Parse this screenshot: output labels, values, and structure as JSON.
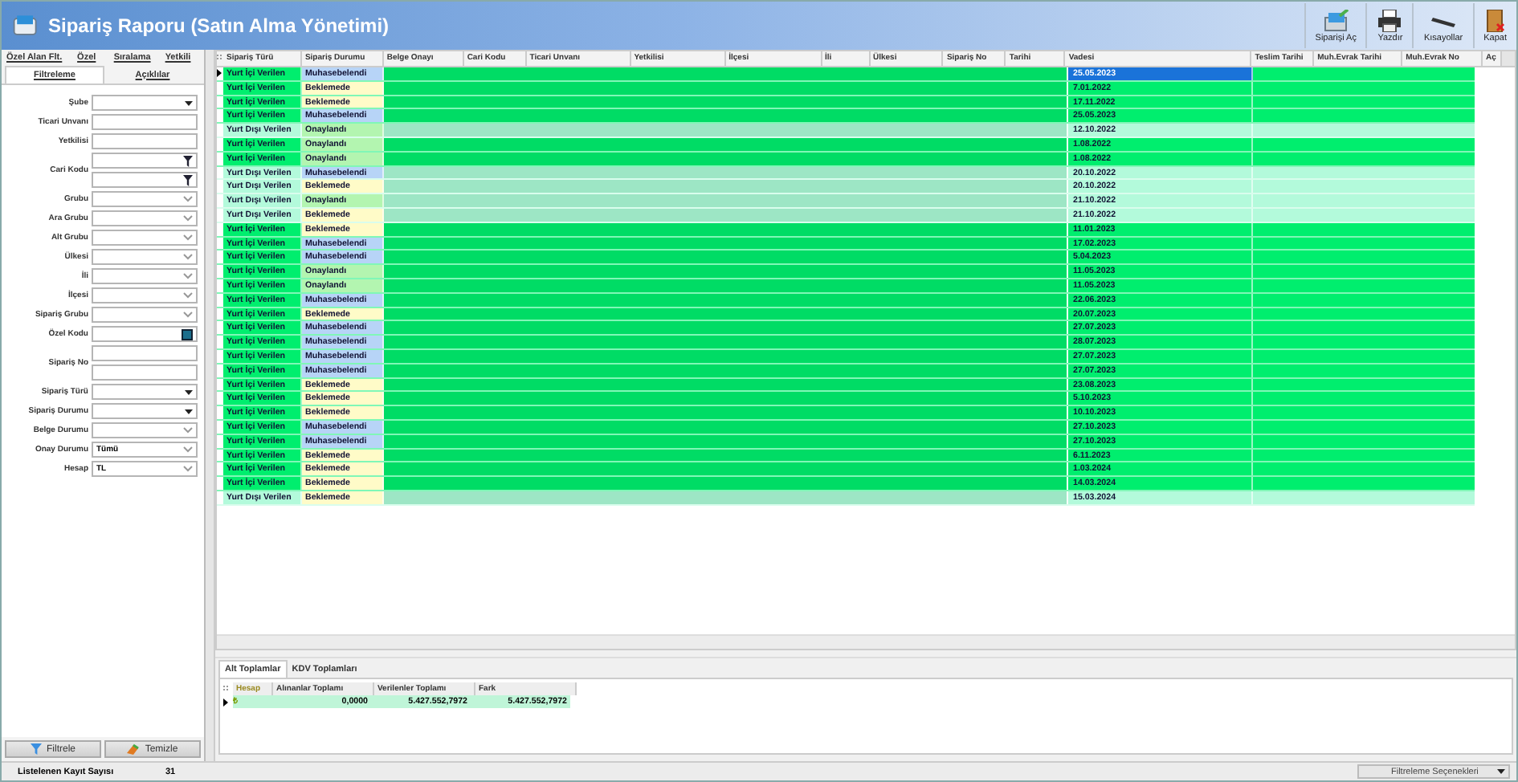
{
  "window": {
    "title": "Sipariş Raporu (Satın Alma Yönetimi)"
  },
  "toolbar": [
    {
      "label": "Siparişi Aç",
      "kind": "open"
    },
    {
      "label": "Yazdır",
      "kind": "print"
    },
    {
      "label": "Kısayollar",
      "kind": "shortcuts"
    },
    {
      "label": "Kapat",
      "kind": "close"
    }
  ],
  "filter_tabs": [
    [
      {
        "label": "Özel Alan Flt.",
        "selected": false
      },
      {
        "label": "Özel",
        "selected": false
      },
      {
        "label": "Sıralama",
        "selected": false
      },
      {
        "label": "Yetkili",
        "selected": false
      }
    ],
    [
      {
        "label": "Filtreleme",
        "selected": true
      },
      {
        "label": "Açıklılar",
        "selected": false
      }
    ]
  ],
  "filters": [
    {
      "label": "Şube",
      "kind": "dropdown"
    },
    {
      "label": "Ticari Unvanı",
      "kind": "text"
    },
    {
      "label": "Yetkilisi",
      "kind": "text"
    },
    {
      "label": "Cari Kodu",
      "kind": "lookup-pair"
    },
    {
      "label": "Grubu",
      "kind": "combo"
    },
    {
      "label": "Ara Grubu",
      "kind": "combo"
    },
    {
      "label": "Alt Grubu",
      "kind": "combo"
    },
    {
      "label": "Ülkesi",
      "kind": "combo"
    },
    {
      "label": "İli",
      "kind": "combo"
    },
    {
      "label": "İlçesi",
      "kind": "combo"
    },
    {
      "label": "Sipariş Grubu",
      "kind": "combo"
    },
    {
      "label": "Özel Kodu",
      "kind": "lookup"
    },
    {
      "label": "Sipariş No",
      "kind": "text-pair"
    },
    {
      "label": "Sipariş Türü",
      "kind": "dropdown"
    },
    {
      "label": "Sipariş Durumu",
      "kind": "dropdown"
    },
    {
      "label": "Belge Durumu",
      "kind": "combo"
    },
    {
      "label": "Onay Durumu",
      "kind": "combo",
      "value": "Tümü"
    },
    {
      "label": "Hesap",
      "kind": "combo",
      "value": "TL"
    }
  ],
  "filter_buttons": [
    {
      "label": "Filtrele",
      "kind": "filter"
    },
    {
      "label": "Temizle",
      "kind": "clear"
    }
  ],
  "status_bar": {
    "label": "Listelenen Kayıt Sayısı",
    "count": "31",
    "options": "Filtreleme Seçenekleri"
  },
  "table": {
    "columns": [
      "Sipariş Türü",
      "Sipariş Durumu",
      "Belge Onayı",
      "Cari Kodu",
      "Ticari Unvanı",
      "Yetkilisi",
      "İlçesi",
      "İli",
      "Ülkesi",
      "Sipariş No",
      "Tarihi",
      "Vadesi",
      "Teslim Tarihi",
      "Muh.Evrak Tarihi",
      "Muh.Evrak No",
      "Aç"
    ],
    "rows": [
      {
        "type": "Yurt İçi Verilen",
        "status": {
          "label": "Muhasebelendi",
          "color": "#b7d4f7"
        },
        "due": "25.05.2023",
        "selected": true,
        "color": "#00ee6e"
      },
      {
        "type": "Yurt İçi Verilen",
        "status": {
          "label": "Beklemede",
          "color": "#fffbc8"
        },
        "due": "7.01.2022",
        "selected": false,
        "color": "#00ee6e"
      },
      {
        "type": "Yurt İçi Verilen",
        "status": {
          "label": "Beklemede",
          "color": "#fffbc8"
        },
        "due": "17.11.2022",
        "selected": false,
        "color": "#00ee6e"
      },
      {
        "type": "Yurt İçi Verilen",
        "status": {
          "label": "Muhasebelendi",
          "color": "#b7d4f7"
        },
        "due": "25.05.2023",
        "selected": false,
        "color": "#00ee6e"
      },
      {
        "type": "Yurt Dışı Verilen",
        "status": {
          "label": "Onaylandı",
          "color": "#b3f5b0"
        },
        "due": "12.10.2022",
        "selected": false,
        "color": "#b3fadb"
      },
      {
        "type": "Yurt İçi Verilen",
        "status": {
          "label": "Onaylandı",
          "color": "#b3f5b0"
        },
        "due": "1.08.2022",
        "selected": false,
        "color": "#00ee6e"
      },
      {
        "type": "Yurt İçi Verilen",
        "status": {
          "label": "Onaylandı",
          "color": "#b3f5b0"
        },
        "due": "1.08.2022",
        "selected": false,
        "color": "#00ee6e"
      },
      {
        "type": "Yurt Dışı Verilen",
        "status": {
          "label": "Muhasebelendi",
          "color": "#b7d4f7"
        },
        "due": "20.10.2022",
        "selected": false,
        "color": "#b3fadb"
      },
      {
        "type": "Yurt Dışı Verilen",
        "status": {
          "label": "Beklemede",
          "color": "#fffbc8"
        },
        "due": "20.10.2022",
        "selected": false,
        "color": "#b3fadb"
      },
      {
        "type": "Yurt Dışı Verilen",
        "status": {
          "label": "Onaylandı",
          "color": "#b3f5b0"
        },
        "due": "21.10.2022",
        "selected": false,
        "color": "#b3fadb"
      },
      {
        "type": "Yurt Dışı Verilen",
        "status": {
          "label": "Beklemede",
          "color": "#fffbc8"
        },
        "due": "21.10.2022",
        "selected": false,
        "color": "#b3fadb"
      },
      {
        "type": "Yurt İçi Verilen",
        "status": {
          "label": "Beklemede",
          "color": "#fffbc8"
        },
        "due": "11.01.2023",
        "selected": false,
        "color": "#00ee6e"
      },
      {
        "type": "Yurt İçi Verilen",
        "status": {
          "label": "Muhasebelendi",
          "color": "#b7d4f7"
        },
        "due": "17.02.2023",
        "selected": false,
        "color": "#00ee6e"
      },
      {
        "type": "Yurt İçi Verilen",
        "status": {
          "label": "Muhasebelendi",
          "color": "#b7d4f7"
        },
        "due": "5.04.2023",
        "selected": false,
        "color": "#00ee6e"
      },
      {
        "type": "Yurt İçi Verilen",
        "status": {
          "label": "Onaylandı",
          "color": "#b3f5b0"
        },
        "due": "11.05.2023",
        "selected": false,
        "color": "#00ee6e"
      },
      {
        "type": "Yurt İçi Verilen",
        "status": {
          "label": "Onaylandı",
          "color": "#b3f5b0"
        },
        "due": "11.05.2023",
        "selected": false,
        "color": "#00ee6e"
      },
      {
        "type": "Yurt İçi Verilen",
        "status": {
          "label": "Muhasebelendi",
          "color": "#b7d4f7"
        },
        "due": "22.06.2023",
        "selected": false,
        "color": "#00ee6e"
      },
      {
        "type": "Yurt İçi Verilen",
        "status": {
          "label": "Beklemede",
          "color": "#fffbc8"
        },
        "due": "20.07.2023",
        "selected": false,
        "color": "#00ee6e"
      },
      {
        "type": "Yurt İçi Verilen",
        "status": {
          "label": "Muhasebelendi",
          "color": "#b7d4f7"
        },
        "due": "27.07.2023",
        "selected": false,
        "color": "#00ee6e"
      },
      {
        "type": "Yurt İçi Verilen",
        "status": {
          "label": "Muhasebelendi",
          "color": "#b7d4f7"
        },
        "due": "28.07.2023",
        "selected": false,
        "color": "#00ee6e"
      },
      {
        "type": "Yurt İçi Verilen",
        "status": {
          "label": "Muhasebelendi",
          "color": "#b7d4f7"
        },
        "due": "27.07.2023",
        "selected": false,
        "color": "#00ee6e"
      },
      {
        "type": "Yurt İçi Verilen",
        "status": {
          "label": "Muhasebelendi",
          "color": "#b7d4f7"
        },
        "due": "27.07.2023",
        "selected": false,
        "color": "#00ee6e"
      },
      {
        "type": "Yurt İçi Verilen",
        "status": {
          "label": "Beklemede",
          "color": "#fffbc8"
        },
        "due": "23.08.2023",
        "selected": false,
        "color": "#00ee6e"
      },
      {
        "type": "Yurt İçi Verilen",
        "status": {
          "label": "Beklemede",
          "color": "#fffbc8"
        },
        "due": "5.10.2023",
        "selected": false,
        "color": "#00ee6e"
      },
      {
        "type": "Yurt İçi Verilen",
        "status": {
          "label": "Beklemede",
          "color": "#fffbc8"
        },
        "due": "10.10.2023",
        "selected": false,
        "color": "#00ee6e"
      },
      {
        "type": "Yurt İçi Verilen",
        "status": {
          "label": "Muhasebelendi",
          "color": "#b7d4f7"
        },
        "due": "27.10.2023",
        "selected": false,
        "color": "#00ee6e"
      },
      {
        "type": "Yurt İçi Verilen",
        "status": {
          "label": "Muhasebelendi",
          "color": "#b7d4f7"
        },
        "due": "27.10.2023",
        "selected": false,
        "color": "#00ee6e"
      },
      {
        "type": "Yurt İçi Verilen",
        "status": {
          "label": "Beklemede",
          "color": "#fffbc8"
        },
        "due": "6.11.2023",
        "selected": false,
        "color": "#00ee6e"
      },
      {
        "type": "Yurt İçi Verilen",
        "status": {
          "label": "Beklemede",
          "color": "#fffbc8"
        },
        "due": "1.03.2024",
        "selected": false,
        "color": "#00ee6e"
      },
      {
        "type": "Yurt İçi Verilen",
        "status": {
          "label": "Beklemede",
          "color": "#fffbc8"
        },
        "due": "14.03.2024",
        "selected": false,
        "color": "#00ee6e"
      },
      {
        "type": "Yurt Dışı Verilen",
        "status": {
          "label": "Beklemede",
          "color": "#fffbc8"
        },
        "due": "15.03.2024",
        "selected": false,
        "color": "#b3fadb"
      }
    ]
  },
  "totals_tabs": [
    {
      "label": "Alt Toplamlar",
      "selected": true
    },
    {
      "label": "KDV Toplamları",
      "selected": false
    }
  ],
  "totals": {
    "columns": [
      "Hesap",
      "Alınanlar Toplamı",
      "Verilenler Toplamı",
      "Fark"
    ],
    "rows": [
      [
        "₺",
        "0,0000",
        "5.427.552,7972",
        "5.427.552,7972"
      ]
    ]
  }
}
